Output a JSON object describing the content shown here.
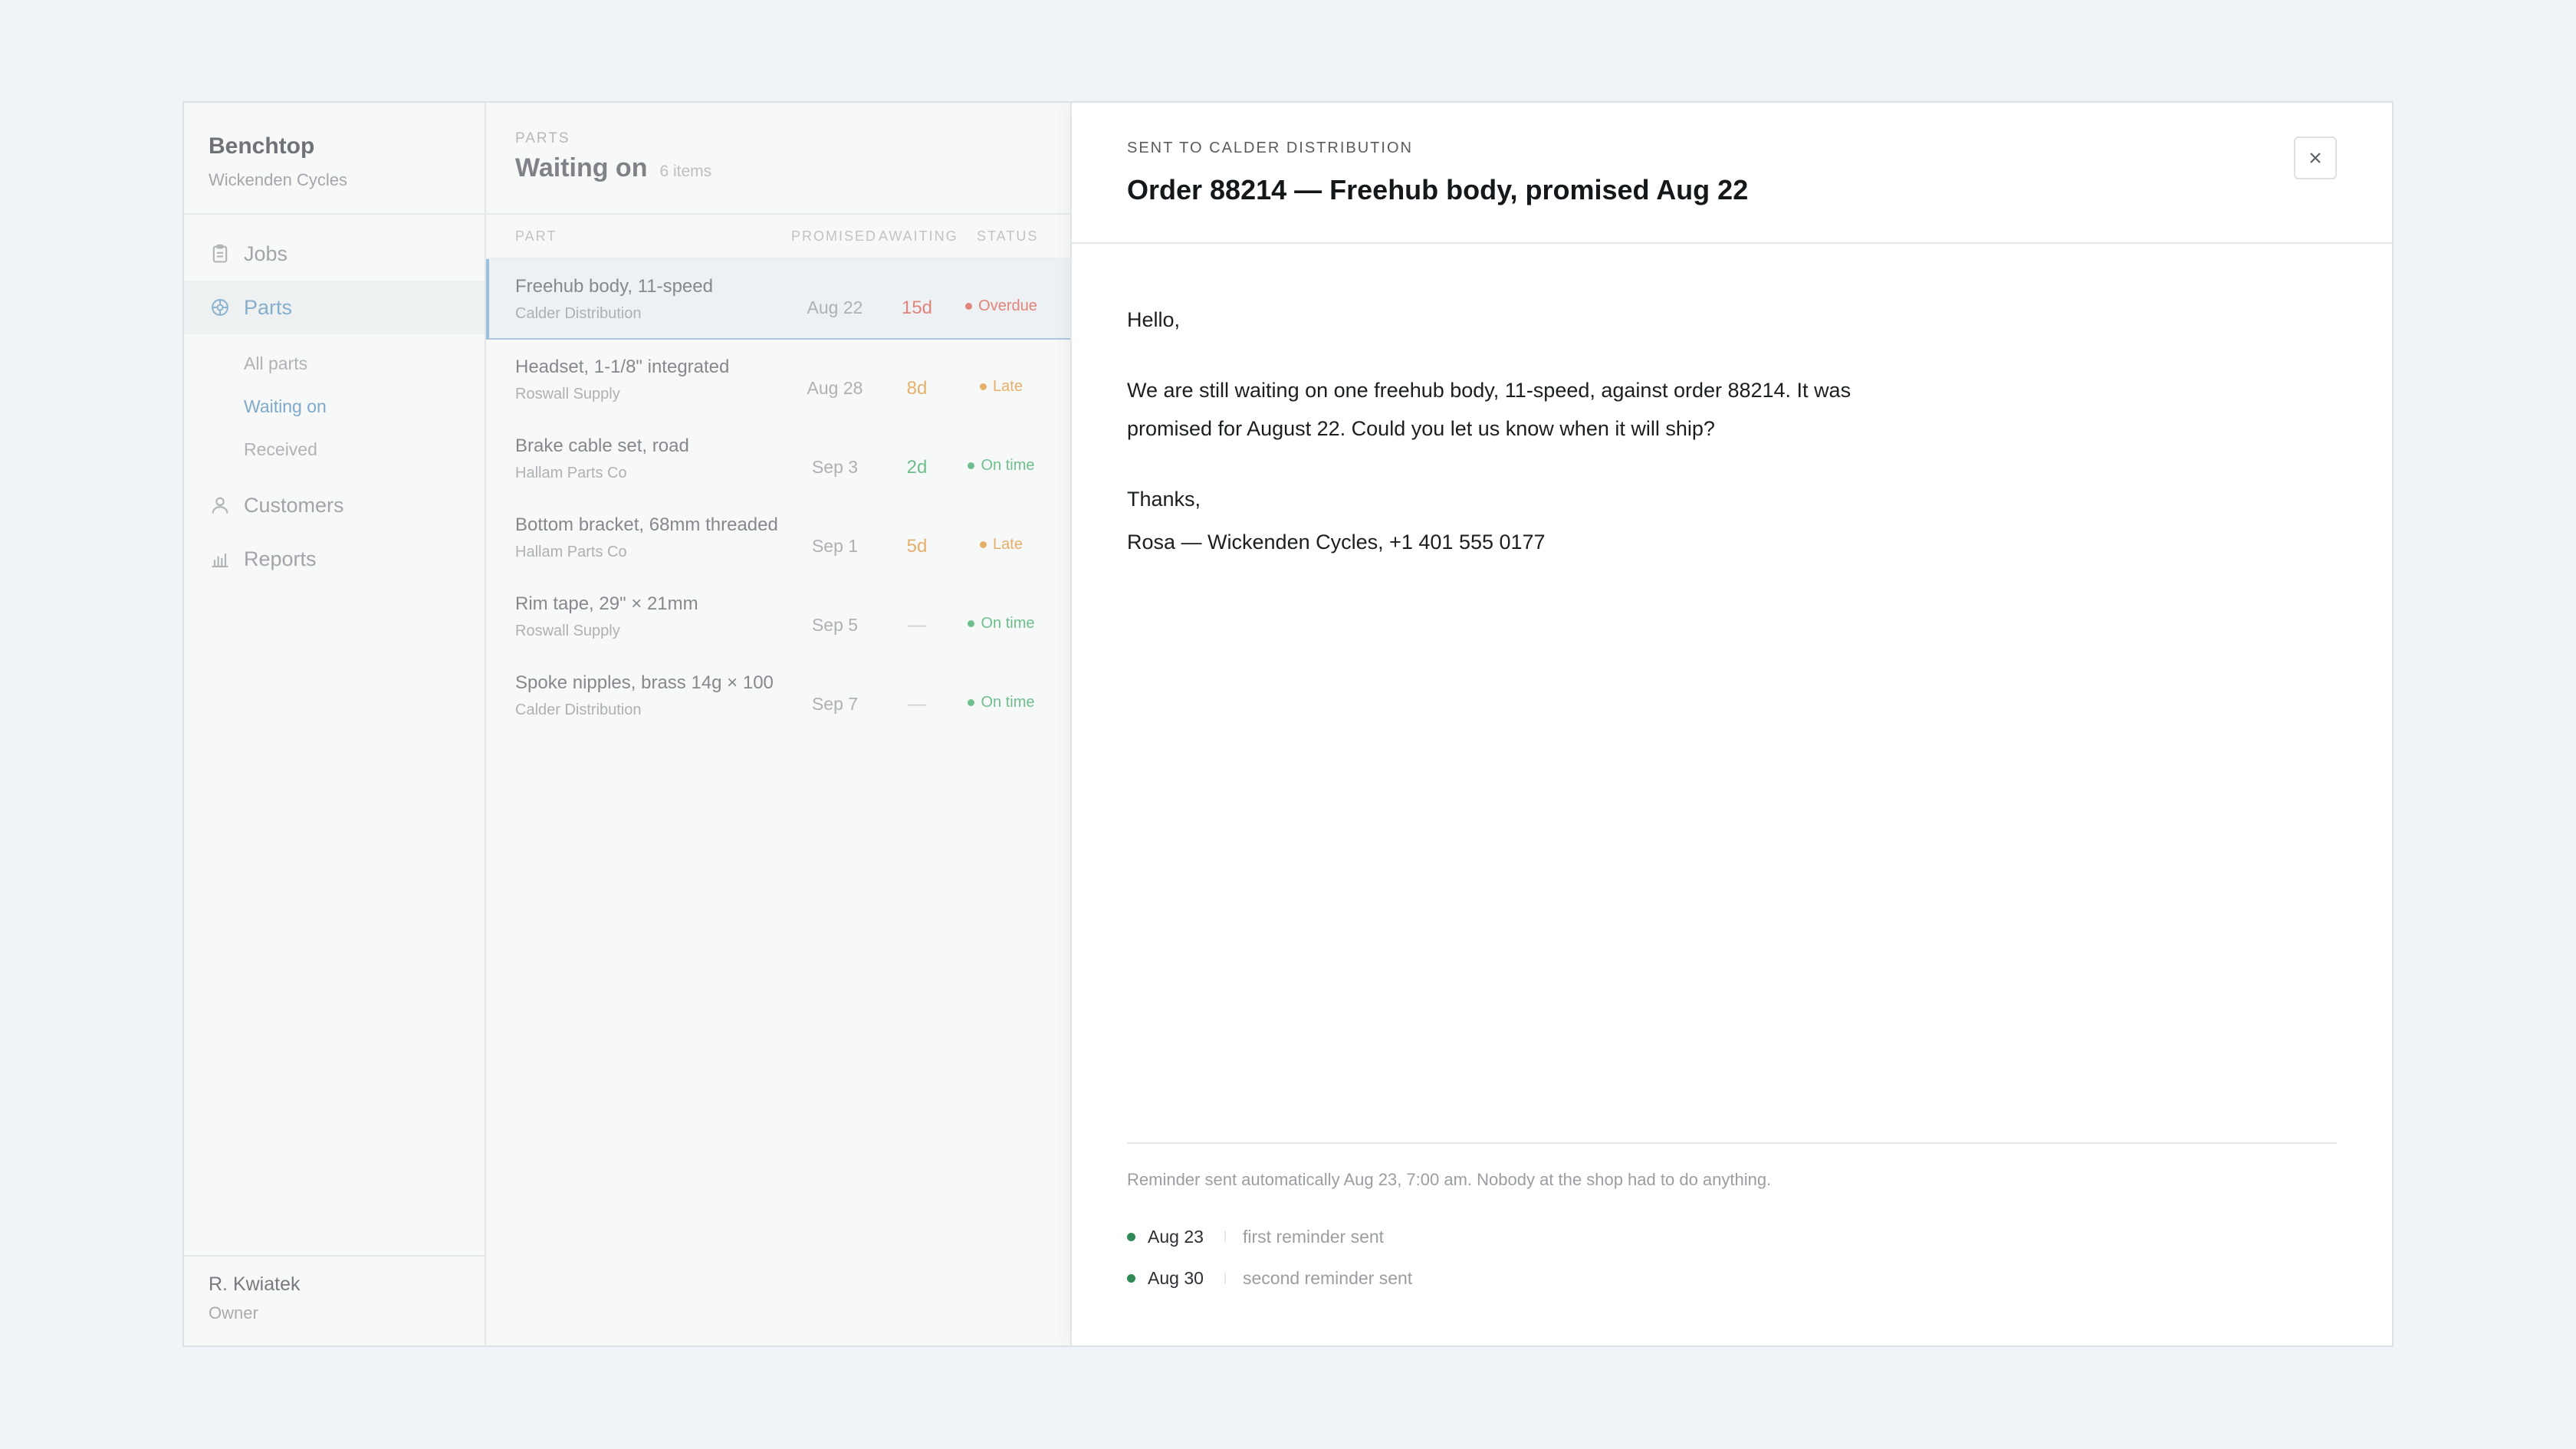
{
  "sidebar": {
    "brand_name": "Benchtop",
    "brand_sub": "Wickenden Cycles",
    "nav": {
      "jobs": "Jobs",
      "parts": "Parts",
      "customers": "Customers",
      "reports": "Reports"
    },
    "subnav": {
      "all_parts": "All parts",
      "waiting_on": "Waiting on",
      "received": "Received"
    },
    "user": {
      "name": "R. Kwiatek",
      "role": "Owner"
    }
  },
  "list": {
    "eyebrow": "PARTS",
    "title": "Waiting on",
    "count": "6 items",
    "columns": {
      "part": "PART",
      "promised": "PROMISED",
      "awaiting": "AWAITING",
      "status": "STATUS"
    },
    "rows": [
      {
        "name": "Freehub body, 11-speed",
        "vendor": "Calder Distribution",
        "promised": "Aug 22",
        "awaiting": "15d",
        "status": "Overdue",
        "color": "#e0847c"
      },
      {
        "name": "Headset, 1-1/8\" integrated",
        "vendor": "Roswall Supply",
        "promised": "Aug 28",
        "awaiting": "8d",
        "status": "Late",
        "color": "#e6b06a"
      },
      {
        "name": "Brake cable set, road",
        "vendor": "Hallam Parts Co",
        "promised": "Sep 3",
        "awaiting": "2d",
        "status": "On time",
        "color": "#6fbf8e"
      },
      {
        "name": "Bottom bracket, 68mm threaded",
        "vendor": "Hallam Parts Co",
        "promised": "Sep 1",
        "awaiting": "5d",
        "status": "Late",
        "color": "#e6b06a"
      },
      {
        "name": "Rim tape, 29\" × 21mm",
        "vendor": "Roswall Supply",
        "promised": "Sep 5",
        "awaiting": "—",
        "status": "On time",
        "color": "#6fbf8e"
      },
      {
        "name": "Spoke nipples, brass 14g × 100",
        "vendor": "Calder Distribution",
        "promised": "Sep 7",
        "awaiting": "—",
        "status": "On time",
        "color": "#6fbf8e"
      }
    ]
  },
  "detail": {
    "eyebrow": "SENT TO CALDER DISTRIBUTION",
    "title": "Order 88214 — Freehub body, promised Aug 22",
    "greeting": "Hello,",
    "message": "We are still waiting on one freehub body, 11-speed, against order 88214. It was promised for August 22. Could you let us know when it will ship?",
    "signoff": "Thanks,",
    "signature": "Rosa — Wickenden Cycles, +1 401 555 0177",
    "footer_note": "Reminder sent automatically Aug 23, 7:00 am. Nobody at the shop had to do anything.",
    "timeline": [
      {
        "date": "Aug 23",
        "text": "first reminder sent"
      },
      {
        "date": "Aug 30",
        "text": "second reminder sent"
      }
    ]
  }
}
